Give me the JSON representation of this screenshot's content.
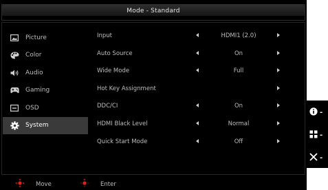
{
  "header": {
    "title": "Mode - Standard"
  },
  "sidebar": {
    "items": [
      {
        "label": "Picture",
        "icon": "picture-icon"
      },
      {
        "label": "Color",
        "icon": "color-palette-icon"
      },
      {
        "label": "Audio",
        "icon": "speaker-icon"
      },
      {
        "label": "Gaming",
        "icon": "gamepad-icon"
      },
      {
        "label": "OSD",
        "icon": "osd-screen-icon"
      },
      {
        "label": "System",
        "icon": "gear-icon",
        "active": true
      }
    ]
  },
  "settings": {
    "rows": [
      {
        "label": "Input",
        "value": "HDMI1 (2.0)",
        "left_arrow": true,
        "right_arrow": true
      },
      {
        "label": "Auto Source",
        "value": "On",
        "left_arrow": true,
        "right_arrow": true
      },
      {
        "label": "Wide Mode",
        "value": "Full",
        "left_arrow": true,
        "right_arrow": true
      },
      {
        "label": "Hot Key Assignment",
        "value": "",
        "left_arrow": false,
        "right_arrow": true
      },
      {
        "label": "DDC/CI",
        "value": "On",
        "left_arrow": true,
        "right_arrow": true
      },
      {
        "label": "HDMI Black Level",
        "value": "Normal",
        "left_arrow": true,
        "right_arrow": true
      },
      {
        "label": "Quick Start Mode",
        "value": "Off",
        "left_arrow": true,
        "right_arrow": true
      }
    ]
  },
  "footer": {
    "move_label": "Move",
    "enter_label": "Enter",
    "move_icon": "joystick-move-icon",
    "enter_icon": "joystick-enter-icon"
  },
  "side_keys": [
    {
      "icon": "info-icon"
    },
    {
      "icon": "menu-grid-icon"
    },
    {
      "icon": "close-icon"
    }
  ],
  "colors": {
    "background": "#000000",
    "active_item": "#3a3a3a",
    "accent_red": "#e02020",
    "text": "#bdbdbd"
  }
}
